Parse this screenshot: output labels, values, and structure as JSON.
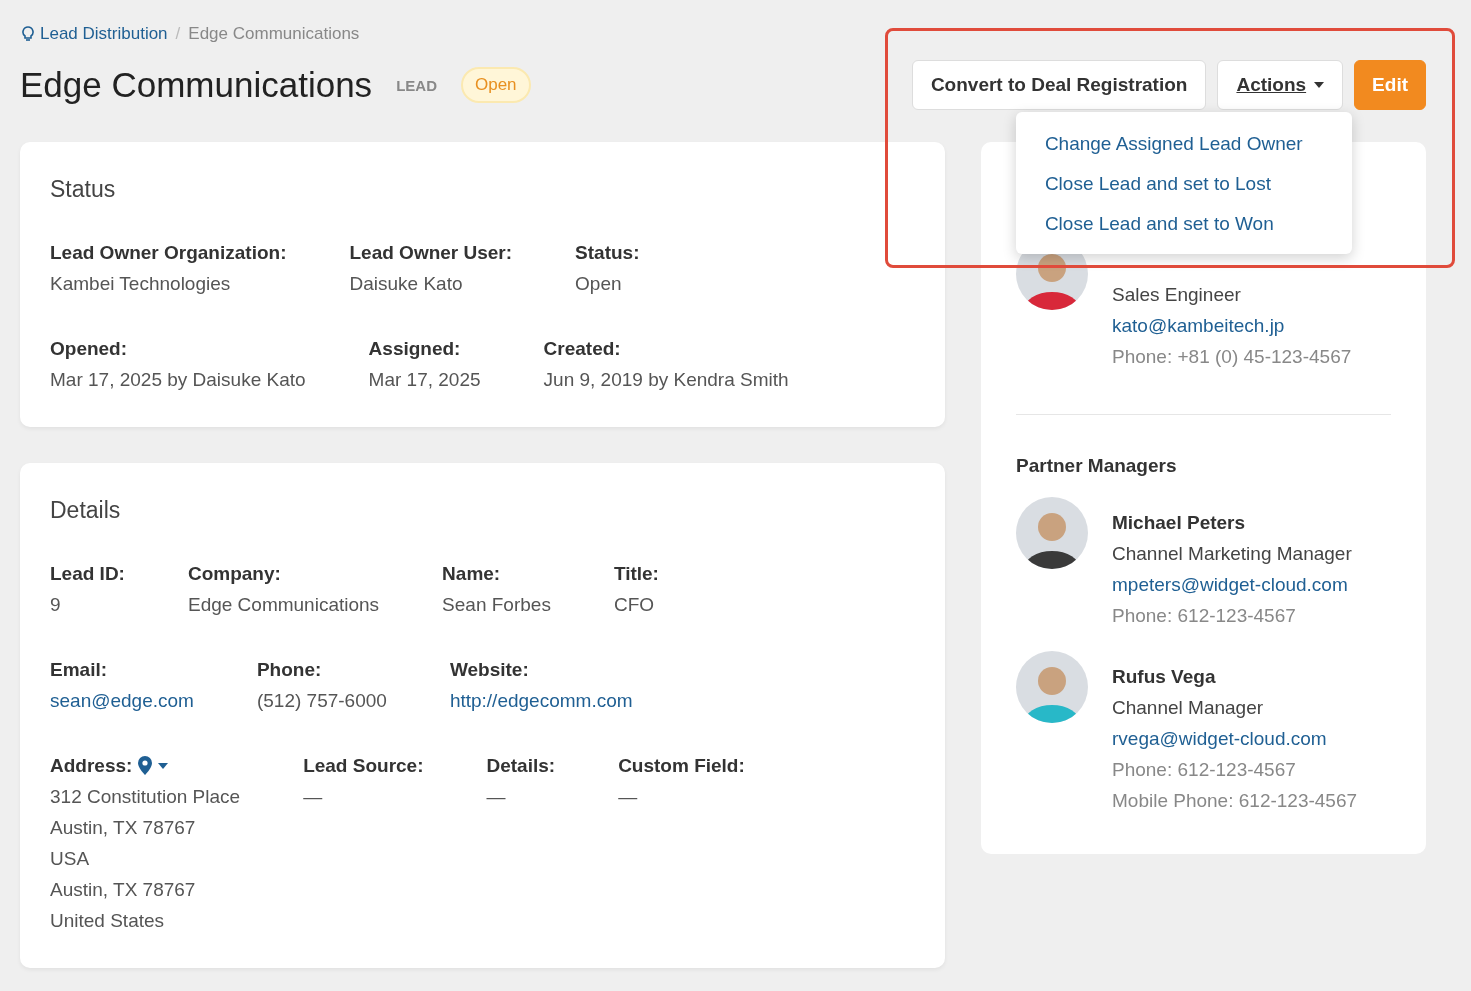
{
  "breadcrumb": [
    {
      "label": "Lead Distribution",
      "kind": "link"
    },
    {
      "label": "Edge Communications",
      "kind": "current"
    }
  ],
  "breadcrumb_separator": "/",
  "title": "Edge Communications",
  "record_type": "LEAD",
  "status_badge": "Open",
  "buttons": [
    {
      "label": "Convert to Deal Registration",
      "kind": "default"
    },
    {
      "label": "Actions",
      "kind": "dropdown",
      "expanded": true
    },
    {
      "label": "Edit",
      "kind": "primary"
    }
  ],
  "actions_menu": [
    "Change Assigned Lead Owner",
    "Close Lead and set to Lost",
    "Close Lead and set to Won"
  ],
  "status_card": {
    "title": "Status",
    "rows": [
      [
        {
          "label": "Lead Owner Organization:",
          "value": "Kambei Technologies",
          "kind": "text"
        },
        {
          "label": "Lead Owner User:",
          "value": "Daisuke Kato",
          "kind": "text"
        },
        {
          "label": "Status:",
          "value": "Open",
          "kind": "text"
        }
      ],
      [
        {
          "label": "Opened:",
          "value": "Mar 17, 2025 by Daisuke Kato",
          "kind": "text"
        },
        {
          "label": "Assigned:",
          "value": "Mar 17, 2025",
          "kind": "text"
        },
        {
          "label": "Created:",
          "value": "Jun 9, 2019 by Kendra Smith",
          "kind": "text"
        }
      ]
    ]
  },
  "details_card": {
    "title": "Details",
    "rows": [
      [
        {
          "label": "Lead ID:",
          "value": "9",
          "kind": "text"
        },
        {
          "label": "Company:",
          "value": "Edge Communications",
          "kind": "text"
        },
        {
          "label": "Name:",
          "value": "Sean Forbes",
          "kind": "text"
        },
        {
          "label": "Title:",
          "value": "CFO",
          "kind": "text"
        }
      ],
      [
        {
          "label": "Email:",
          "value": "sean@edge.com",
          "kind": "link"
        },
        {
          "label": "Phone:",
          "value": "(512) 757-6000",
          "kind": "text"
        },
        {
          "label": "Website:",
          "value": "http://edgecomm.com",
          "kind": "link"
        }
      ],
      [
        {
          "label": "Address:",
          "lines": [
            "312 Constitution Place",
            "Austin, TX 78767",
            "USA",
            "Austin, TX 78767",
            "United States"
          ],
          "kind": "address"
        },
        {
          "label": "Lead Source:",
          "value": "—",
          "kind": "text"
        },
        {
          "label": "Details:",
          "value": "—",
          "kind": "text"
        },
        {
          "label": "Custom Field:",
          "value": "—",
          "kind": "text"
        }
      ]
    ]
  },
  "lead_owner": {
    "title": "Sales Engineer",
    "email": "kato@kambeitech.jp",
    "phones": [
      {
        "label": "Phone:",
        "value": "+81 (0) 45-123-4567"
      }
    ]
  },
  "partner_managers": {
    "heading": "Partner Managers",
    "people": [
      {
        "name": "Michael Peters",
        "title": "Channel Marketing Manager",
        "email": "mpeters@widget-cloud.com",
        "phones": [
          {
            "label": "Phone:",
            "value": "612-123-4567"
          }
        ]
      },
      {
        "name": "Rufus Vega",
        "title": "Channel Manager",
        "email": "rvega@widget-cloud.com",
        "phones": [
          {
            "label": "Phone:",
            "value": "612-123-4567"
          },
          {
            "label": "Mobile Phone:",
            "value": "612-123-4567"
          }
        ]
      }
    ]
  }
}
